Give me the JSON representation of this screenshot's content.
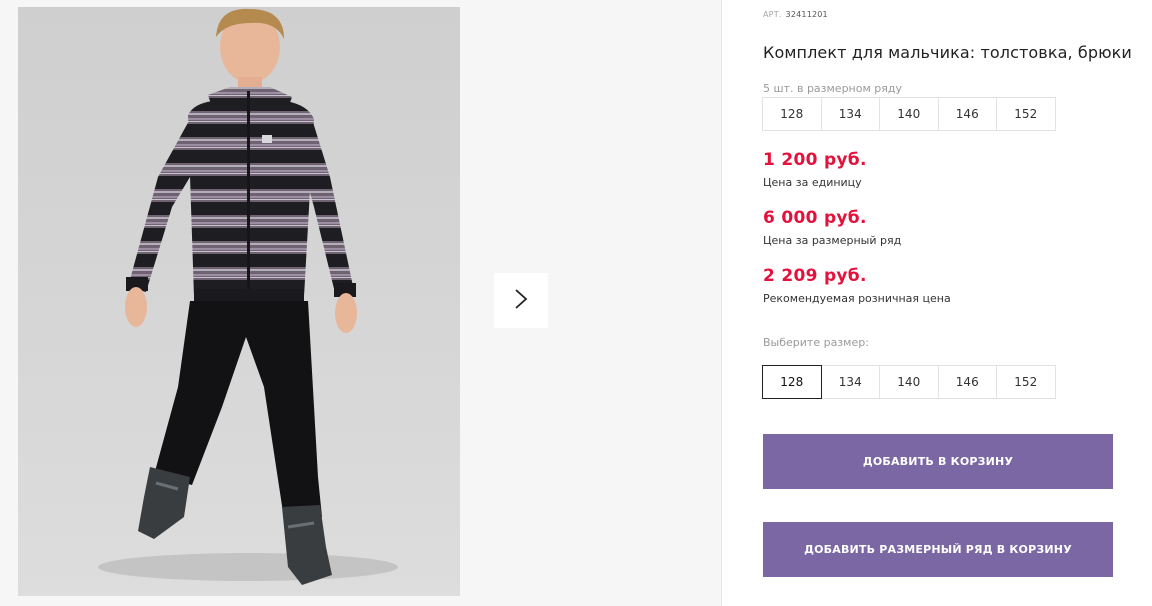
{
  "product": {
    "art_label": "АРТ.",
    "art_value": "32411201",
    "title": "Комплект для мальчика: толстовка, брюки",
    "range_label": "5 шт. в размерном ряду",
    "range_sizes": [
      "128",
      "134",
      "140",
      "146",
      "152"
    ],
    "prices": [
      {
        "value": "1 200 руб.",
        "caption": "Цена за единицу"
      },
      {
        "value": "6 000 руб.",
        "caption": "Цена за размерный ряд"
      },
      {
        "value": "2 209 руб.",
        "caption": "Рекомендуемая розничная цена"
      }
    ],
    "choose_size_label": "Выберите размер:",
    "size_options": [
      "128",
      "134",
      "140",
      "146",
      "152"
    ],
    "selected_size": "128"
  },
  "actions": {
    "add_to_cart": "ДОБАВИТЬ В КОРЗИНУ",
    "add_range_to_cart": "ДОБАВИТЬ РАЗМЕРНЫЙ РЯД В КОРЗИНУ"
  },
  "gallery": {
    "next_icon": "chevron-right-icon"
  },
  "colors": {
    "price": "#e3113b",
    "button": "#7a67a4",
    "button_text": "#ffffff"
  }
}
